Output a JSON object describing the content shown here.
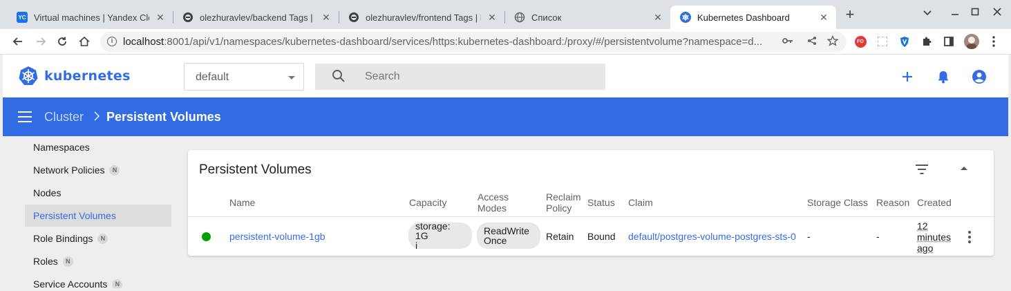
{
  "browser": {
    "tabs": [
      {
        "title": "Virtual machines | Yandex Cloud",
        "favicon": "YC",
        "active": false
      },
      {
        "title": "olezhuravlev/backend Tags | Docker Hub",
        "favicon": "docker-icon",
        "active": false
      },
      {
        "title": "olezhuravlev/frontend Tags | Docker Hub",
        "favicon": "docker-icon",
        "active": false
      },
      {
        "title": "Список",
        "favicon": "globe-icon",
        "active": false
      },
      {
        "title": "Kubernetes Dashboard",
        "favicon": "kubernetes-icon",
        "active": true
      }
    ],
    "new_tab": "+",
    "url_host": "localhost",
    "url_rest": ":8001/api/v1/namespaces/kubernetes-dashboard/services/https:kubernetes-dashboard:/proxy/#/persistentvolume?namespace=d...",
    "ext_label": "FO"
  },
  "app": {
    "brand": "kubernetes",
    "namespace": "default",
    "search_placeholder": "Search",
    "accent": "#326ce5"
  },
  "breadcrumb": {
    "parent": "Cluster",
    "separator": ">",
    "current": "Persistent Volumes"
  },
  "sidebar": {
    "items": [
      {
        "label": "Namespaces",
        "badge": ""
      },
      {
        "label": "Network Policies",
        "badge": "N"
      },
      {
        "label": "Nodes",
        "badge": ""
      },
      {
        "label": "Persistent Volumes",
        "badge": "",
        "active": true
      },
      {
        "label": "Role Bindings",
        "badge": "N"
      },
      {
        "label": "Roles",
        "badge": "N"
      },
      {
        "label": "Service Accounts",
        "badge": "N"
      }
    ]
  },
  "card": {
    "title": "Persistent Volumes",
    "columns": {
      "name": "Name",
      "capacity": "Capacity",
      "access_1": "Access",
      "access_2": "Modes",
      "reclaim_1": "Reclaim",
      "reclaim_2": "Policy",
      "status": "Status",
      "claim": "Claim",
      "storage_class": "Storage Class",
      "reason": "Reason",
      "created": "Created"
    },
    "rows": [
      {
        "name": "persistent-volume-1gb",
        "capacity_1": "storage: 1G",
        "capacity_2": "i",
        "access_1": "ReadWrite",
        "access_2": "Once",
        "reclaim": "Retain",
        "status": "Bound",
        "claim": "default/postgres-volume-postgres-sts-0",
        "storage_class": "-",
        "reason": "-",
        "created_1": "12",
        "created_2": "minutes",
        "created_3": "ago",
        "status_color": "#00a000"
      }
    ]
  }
}
